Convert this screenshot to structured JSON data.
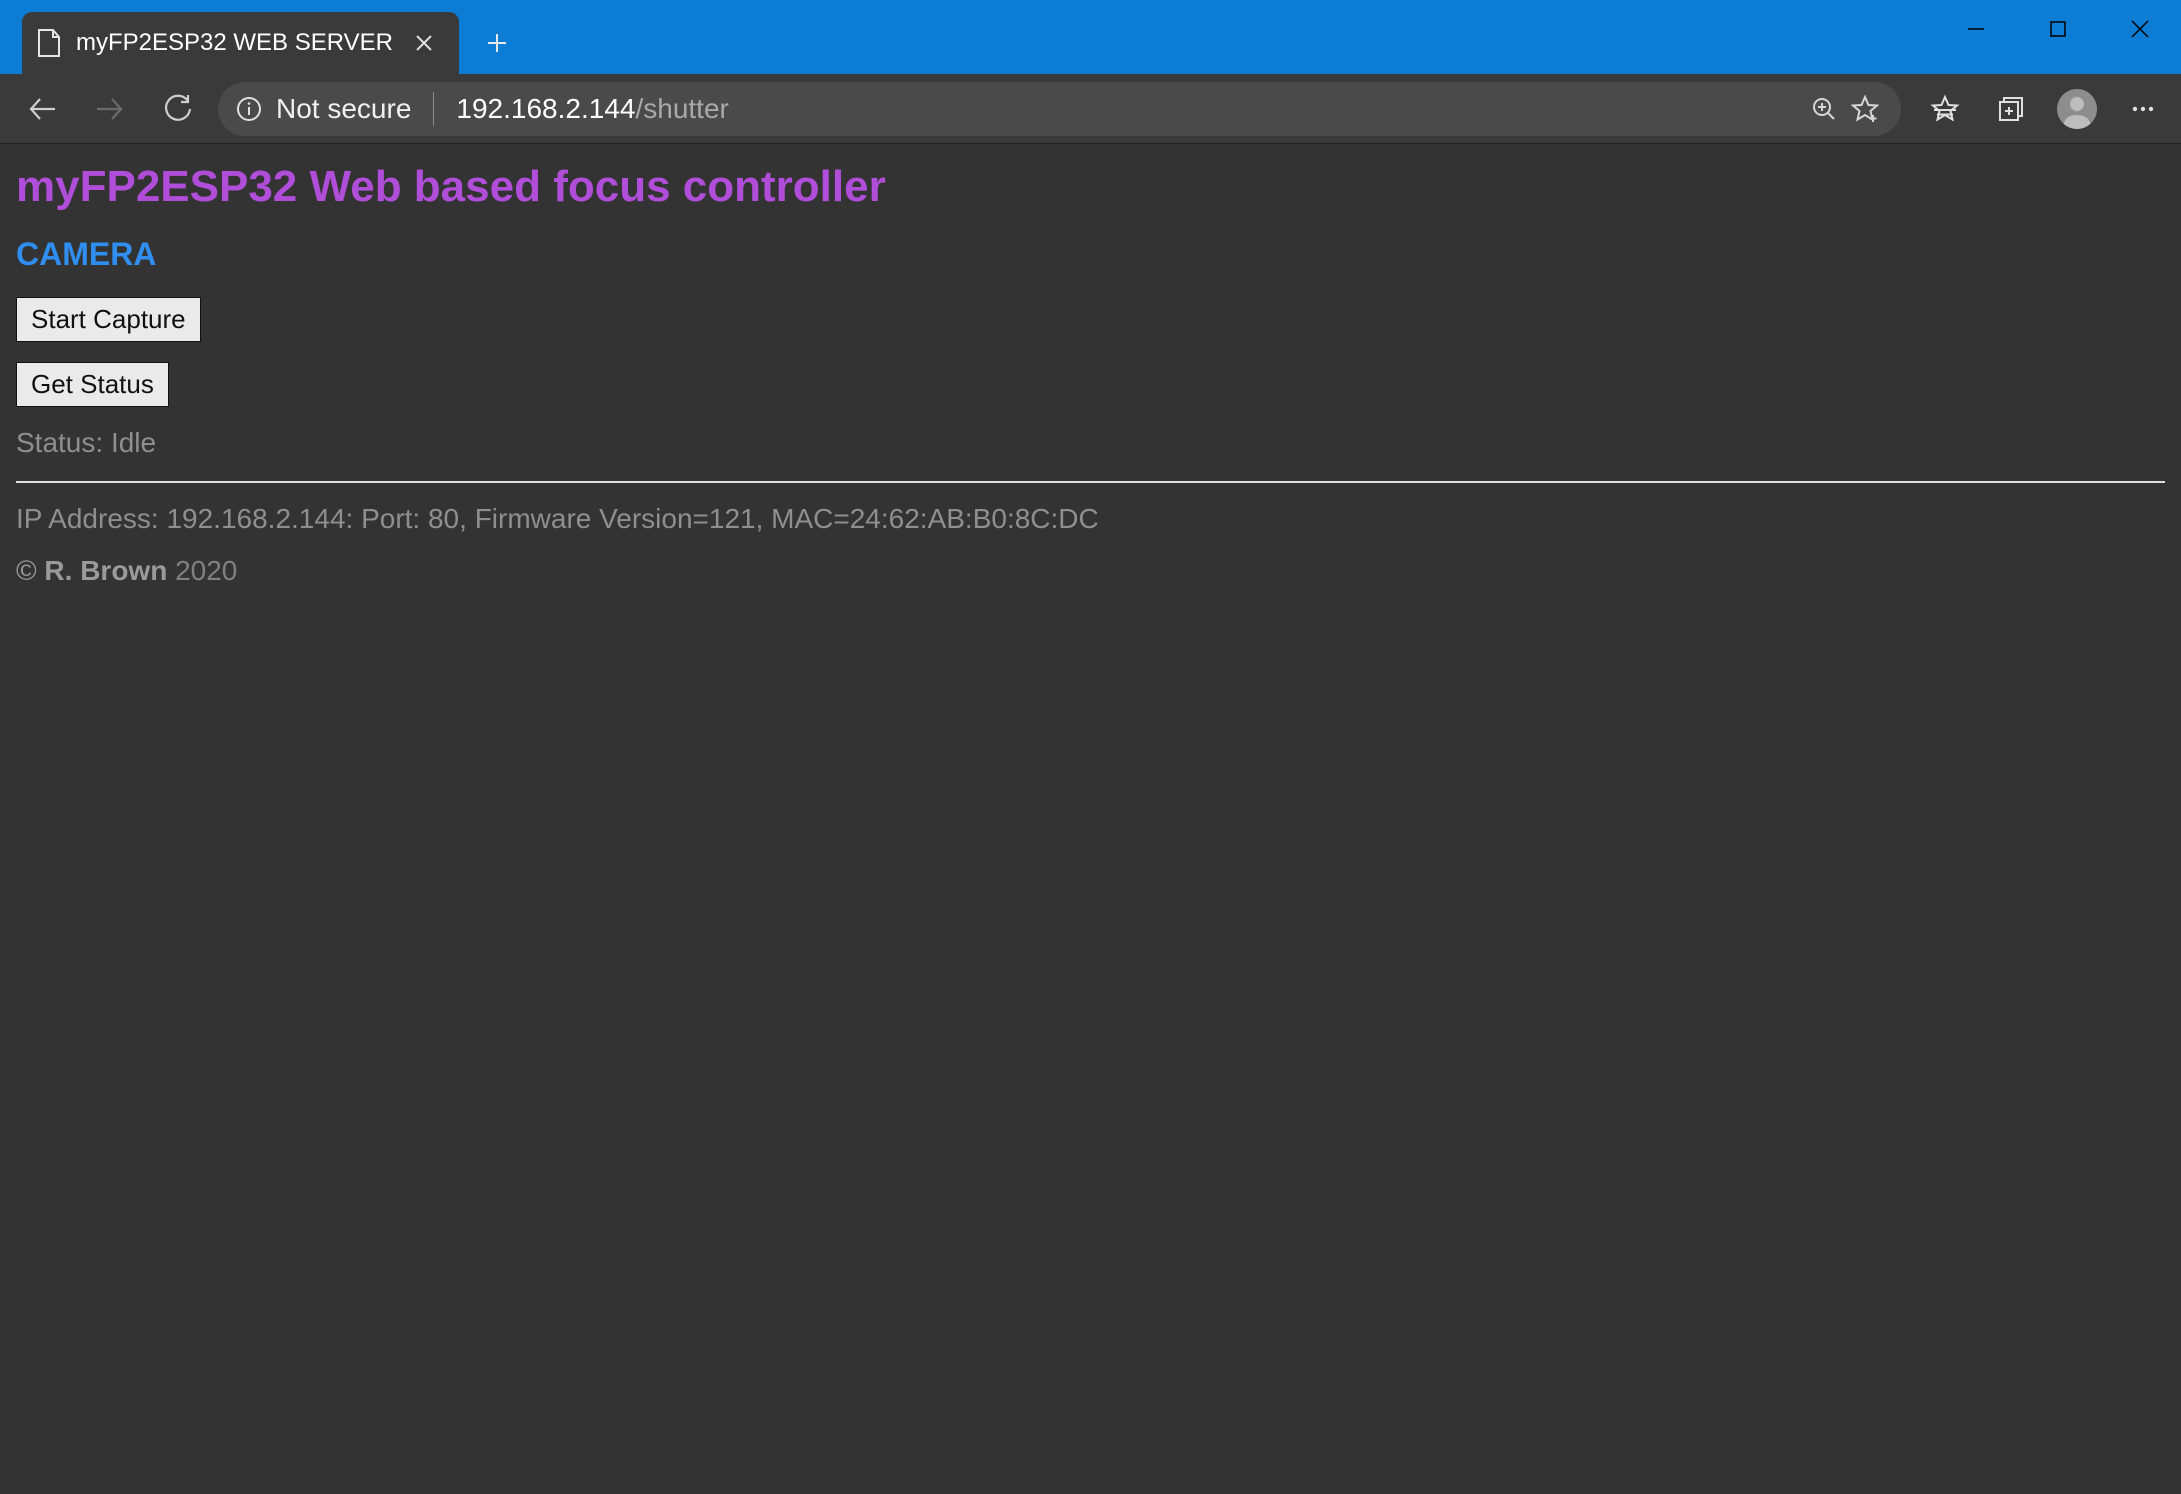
{
  "window": {
    "tab_title": "myFP2ESP32 WEB SERVER"
  },
  "addressbar": {
    "security_label": "Not secure",
    "url_host": "192.168.2.144",
    "url_path": "/shutter"
  },
  "page": {
    "h1": "myFP2ESP32 Web based focus controller",
    "h2": "CAMERA",
    "buttons": {
      "start_capture": "Start Capture",
      "get_status": "Get Status"
    },
    "status_label": "Status:",
    "status_value": "Idle",
    "footer_info": "IP Address: 192.168.2.144: Port: 80, Firmware Version=121, MAC=24:62:AB:B0:8C:DC",
    "copyright_symbol": "©",
    "author": "R. Brown",
    "year": "2020"
  }
}
